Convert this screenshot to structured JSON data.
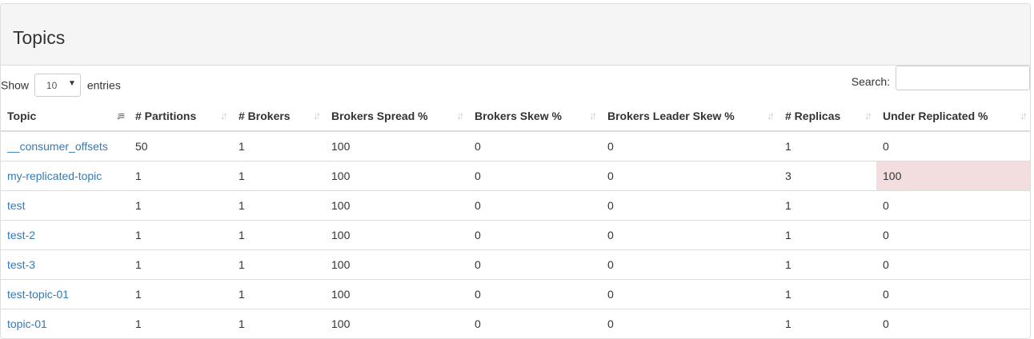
{
  "panel": {
    "title": "Topics"
  },
  "controls": {
    "show_label": "Show",
    "page_length": "10",
    "entries_label": "entries",
    "search_label": "Search:",
    "search_value": ""
  },
  "table": {
    "columns": [
      {
        "label": "Topic",
        "sorted": true
      },
      {
        "label": "# Partitions",
        "sorted": false
      },
      {
        "label": "# Brokers",
        "sorted": false
      },
      {
        "label": "Brokers Spread %",
        "sorted": false
      },
      {
        "label": "Brokers Skew %",
        "sorted": false
      },
      {
        "label": "Brokers Leader Skew %",
        "sorted": false
      },
      {
        "label": "# Replicas",
        "sorted": false
      },
      {
        "label": "Under Replicated %",
        "sorted": false
      }
    ],
    "rows": [
      {
        "topic": "__consumer_offsets",
        "partitions": "50",
        "brokers": "1",
        "spread": "100",
        "skew": "0",
        "leader_skew": "0",
        "replicas": "1",
        "under_replicated": "0",
        "under_replicated_warning": false
      },
      {
        "topic": "my-replicated-topic",
        "partitions": "1",
        "brokers": "1",
        "spread": "100",
        "skew": "0",
        "leader_skew": "0",
        "replicas": "3",
        "under_replicated": "100",
        "under_replicated_warning": true
      },
      {
        "topic": "test",
        "partitions": "1",
        "brokers": "1",
        "spread": "100",
        "skew": "0",
        "leader_skew": "0",
        "replicas": "1",
        "under_replicated": "0",
        "under_replicated_warning": false
      },
      {
        "topic": "test-2",
        "partitions": "1",
        "brokers": "1",
        "spread": "100",
        "skew": "0",
        "leader_skew": "0",
        "replicas": "1",
        "under_replicated": "0",
        "under_replicated_warning": false
      },
      {
        "topic": "test-3",
        "partitions": "1",
        "brokers": "1",
        "spread": "100",
        "skew": "0",
        "leader_skew": "0",
        "replicas": "1",
        "under_replicated": "0",
        "under_replicated_warning": false
      },
      {
        "topic": "test-topic-01",
        "partitions": "1",
        "brokers": "1",
        "spread": "100",
        "skew": "0",
        "leader_skew": "0",
        "replicas": "1",
        "under_replicated": "0",
        "under_replicated_warning": false
      },
      {
        "topic": "topic-01",
        "partitions": "1",
        "brokers": "1",
        "spread": "100",
        "skew": "0",
        "leader_skew": "0",
        "replicas": "1",
        "under_replicated": "0",
        "under_replicated_warning": false
      }
    ]
  },
  "colors": {
    "link": "#337ab7",
    "warning_row": "#f2dede",
    "panel_heading": "#f5f5f5"
  },
  "icons": {
    "sort_active": "sort-alpha-asc-icon",
    "sort_inactive": "sort-both-icon"
  }
}
